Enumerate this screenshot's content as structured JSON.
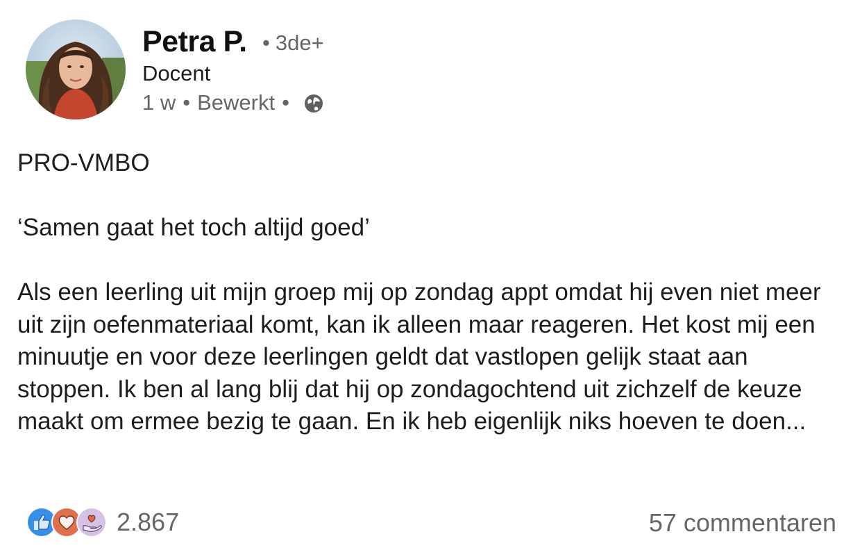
{
  "post": {
    "author": {
      "name": "Petra P.",
      "degree_separator": "•",
      "degree": "3de+",
      "headline": "Docent",
      "avatar_icon": "profile-photo"
    },
    "meta": {
      "time": "1 w",
      "separator": "•",
      "edited": "Bewerkt",
      "visibility_icon": "globe-icon"
    },
    "body": {
      "title": "PRO-VMBO",
      "quote": "‘Samen gaat het toch altijd goed’",
      "paragraph": "Als een leerling uit mijn groep mij op zondag appt omdat hij even niet meer uit zijn oefenmateriaal komt, kan ik alleen maar reageren. Het kost mij een minuutje en voor deze leerlingen geldt dat vastlopen gelijk staat aan stoppen. Ik ben al lang blij dat hij op zondagochtend uit zichzelf de keuze maakt om ermee bezig te gaan. En ik heb eigenlijk niks hoeven te doen..."
    },
    "social": {
      "reaction_icons": [
        "like-icon",
        "love-icon",
        "support-icon"
      ],
      "reaction_colors": {
        "like": "#378fe9",
        "love": "#df704d",
        "support": "#d5c2e6"
      },
      "reaction_count": "2.867",
      "comments": "57 commentaren"
    }
  }
}
